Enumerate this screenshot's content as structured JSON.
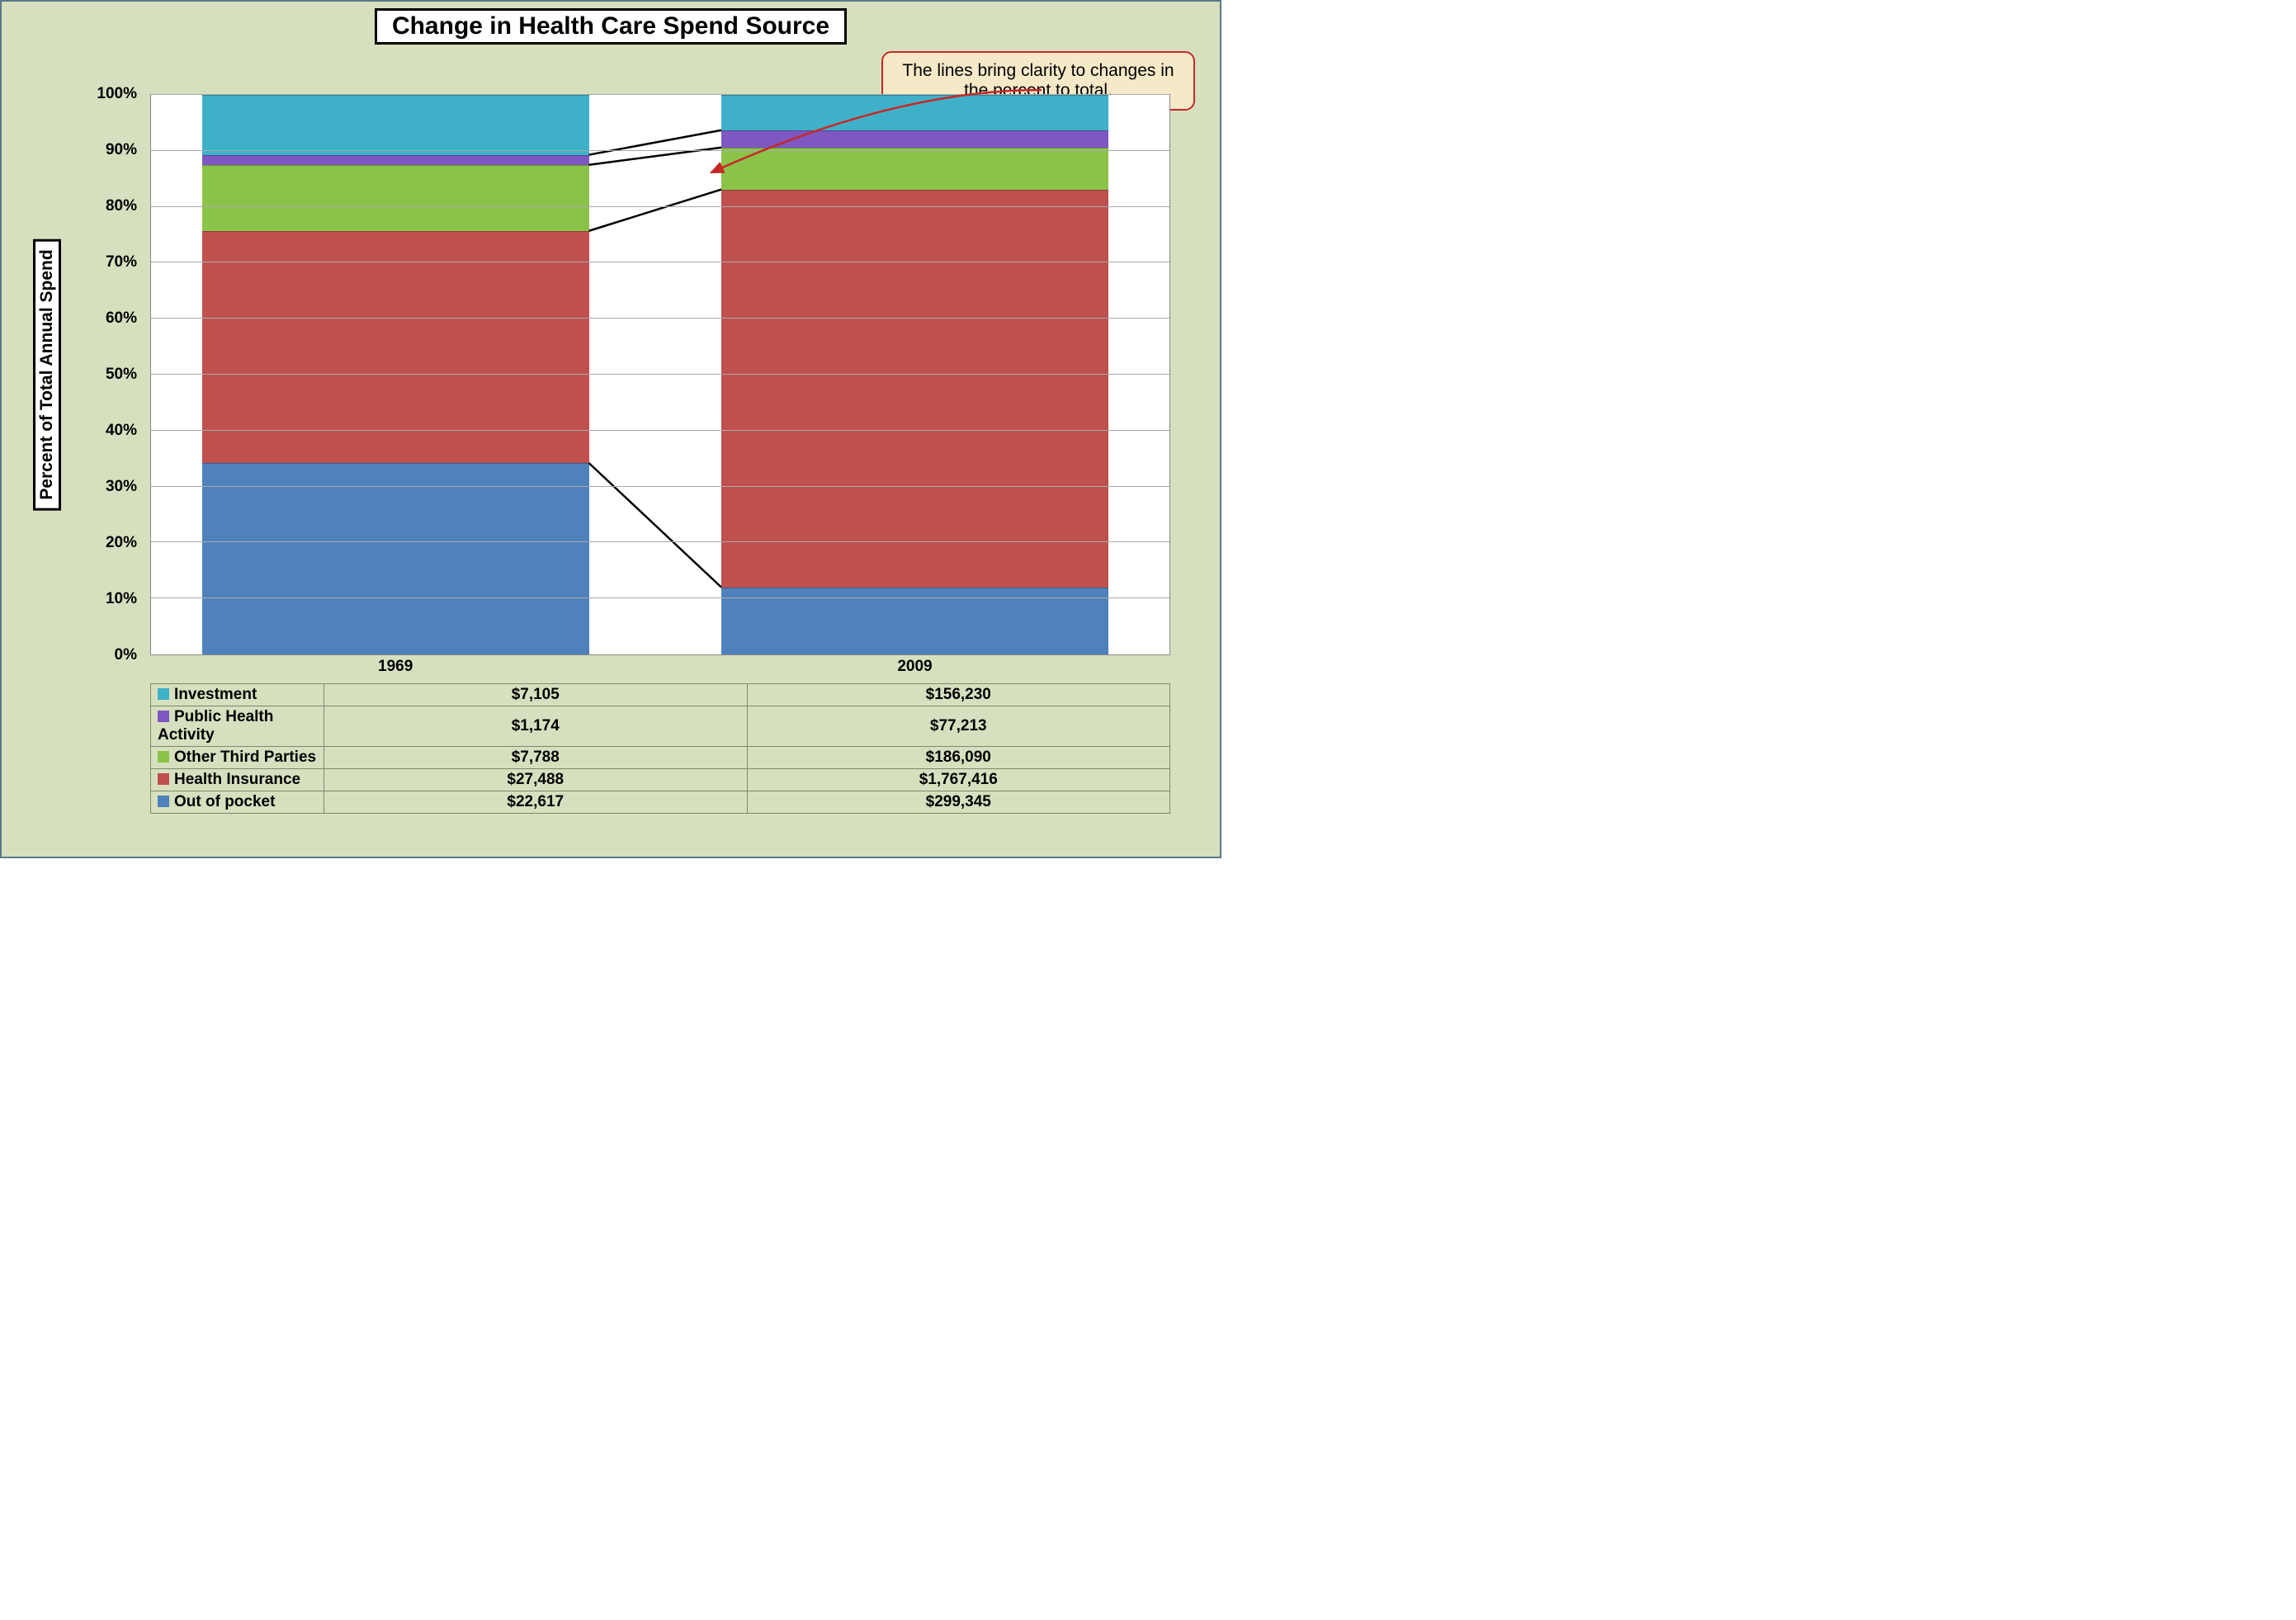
{
  "title": "Change in Health Care Spend Source",
  "yaxis_title": "Percent of Total Annual Spend",
  "callout": "The lines bring clarity to changes in the percent to total.",
  "yticks": [
    "0%",
    "10%",
    "20%",
    "30%",
    "40%",
    "50%",
    "60%",
    "70%",
    "80%",
    "90%",
    "100%"
  ],
  "categories": [
    "1969",
    "2009"
  ],
  "series": [
    {
      "name": "Investment",
      "color": "#3eb1c8",
      "values_label": [
        "$7,105",
        "$156,230"
      ]
    },
    {
      "name": "Public Health Activity",
      "color": "#7e57c2",
      "values_label": [
        "$1,174",
        "$77,213"
      ]
    },
    {
      "name": "Other Third Parties",
      "color": "#8bc34a",
      "values_label": [
        "$7,788",
        "$186,090"
      ]
    },
    {
      "name": "Health Insurance",
      "color": "#c0504d",
      "values_label": [
        "$27,488",
        "$1,767,416"
      ]
    },
    {
      "name": "Out of pocket",
      "color": "#4f81bd",
      "values_label": [
        "$22,617",
        "$299,345"
      ]
    }
  ],
  "chart_data": {
    "type": "bar",
    "subtype": "stacked-100pct-with-connectors",
    "title": "Change in Health Care Spend Source",
    "ylabel": "Percent of Total Annual Spend",
    "ylim": [
      0,
      100
    ],
    "categories": [
      "1969",
      "2009"
    ],
    "series": [
      {
        "name": "Out of pocket",
        "values": [
          22617,
          299345
        ]
      },
      {
        "name": "Health Insurance",
        "values": [
          27488,
          1767416
        ]
      },
      {
        "name": "Other Third Parties",
        "values": [
          7788,
          186090
        ]
      },
      {
        "name": "Public Health Activity",
        "values": [
          1174,
          77213
        ]
      },
      {
        "name": "Investment",
        "values": [
          7105,
          156230
        ]
      }
    ],
    "percent_stacked": [
      {
        "name": "Out of pocket",
        "pct": [
          34.2,
          12.0
        ]
      },
      {
        "name": "Health Insurance",
        "pct": [
          41.5,
          71.1
        ]
      },
      {
        "name": "Other Third Parties",
        "pct": [
          11.8,
          7.5
        ]
      },
      {
        "name": "Public Health Activity",
        "pct": [
          1.8,
          3.1
        ]
      },
      {
        "name": "Investment",
        "pct": [
          10.7,
          6.3
        ]
      }
    ],
    "annotations": [
      "The lines bring clarity to changes in the percent to total."
    ]
  }
}
